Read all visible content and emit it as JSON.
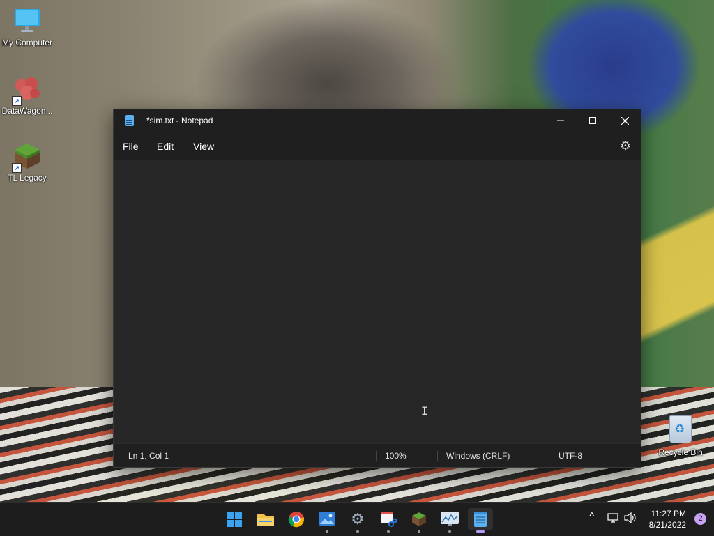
{
  "desktop": {
    "icons": [
      {
        "label": "My Computer"
      },
      {
        "label": "DataWagon..."
      },
      {
        "label": "TL Legacy"
      }
    ],
    "recycle_bin": {
      "label": "Recycle Bin"
    }
  },
  "notepad": {
    "title": "*sim.txt - Notepad",
    "menus": [
      "File",
      "Edit",
      "View"
    ],
    "status": {
      "position": "Ln 1, Col 1",
      "zoom": "100%",
      "line_ending": "Windows (CRLF)",
      "encoding": "UTF-8"
    }
  },
  "taskbar": {
    "apps": [
      {
        "name": "start",
        "icon": "windows-logo-icon",
        "running": false,
        "active": false
      },
      {
        "name": "file-explorer",
        "icon": "folder-icon",
        "running": false,
        "active": false
      },
      {
        "name": "chrome",
        "icon": "chrome-icon",
        "running": false,
        "active": false
      },
      {
        "name": "photos",
        "icon": "photos-icon",
        "running": true,
        "active": false
      },
      {
        "name": "settings",
        "icon": "gear-icon",
        "running": true,
        "active": false
      },
      {
        "name": "snipping-tool",
        "icon": "snipping-tool-icon",
        "running": true,
        "active": false
      },
      {
        "name": "tl-legacy",
        "icon": "minecraft-block-icon",
        "running": true,
        "active": false
      },
      {
        "name": "resource-monitor",
        "icon": "monitor-chart-icon",
        "running": true,
        "active": false
      },
      {
        "name": "notepad",
        "icon": "notepad-icon",
        "running": true,
        "active": true
      }
    ],
    "clock": {
      "time": "11:27 PM",
      "date": "8/21/2022"
    },
    "notification_count": "2"
  },
  "colors": {
    "window_bg": "#1f1f1f",
    "editor_bg": "#272727",
    "taskbar_bg": "#1d1d1d",
    "accent": "#b79cf5"
  }
}
